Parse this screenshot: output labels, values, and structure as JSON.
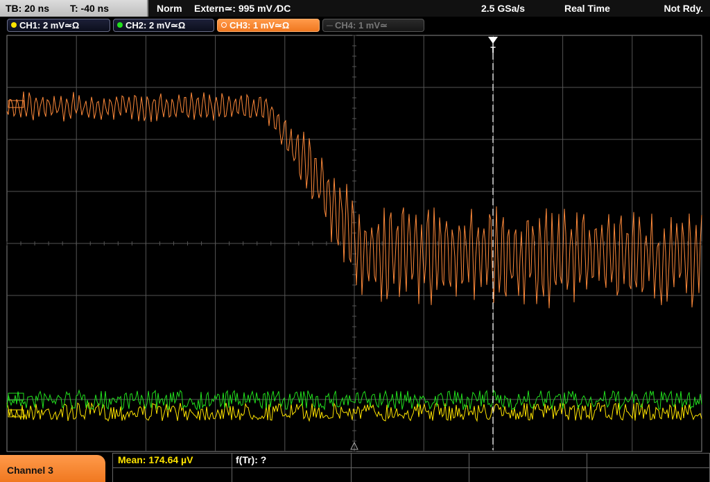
{
  "status_bar": {
    "timebase": "TB: 20 ns",
    "trigger_offset": "T: -40 ns",
    "trigger_mode": "Norm",
    "trigger_source": "Extern≃: 995 mV ∕DC",
    "sample_rate": "2.5 GSa/s",
    "acquisition_mode": "Real Time",
    "acquisition_state": "Not Rdy."
  },
  "channels": [
    {
      "id": "ch1",
      "label": "CH1: 2 mV≃Ω",
      "color": "#ffe400",
      "active": false,
      "enabled": true
    },
    {
      "id": "ch2",
      "label": "CH2: 2 mV≃Ω",
      "color": "#22e01e",
      "active": false,
      "enabled": true
    },
    {
      "id": "ch3",
      "label": "CH3: 1 mV≃Ω",
      "color": "#ff8a3a",
      "active": true,
      "enabled": true
    },
    {
      "id": "ch4",
      "label": "CH4: 1 mV≃",
      "color": "#555555",
      "active": false,
      "enabled": false
    }
  ],
  "trigger_marker": "T",
  "bottom": {
    "channel_tab": "Channel 3",
    "measurement_mean": "Mean: 174.64 µV",
    "measurement_ftr": "f(Tr): ?"
  },
  "colors": {
    "grid": "#555555",
    "ch3": "#ff8a3a",
    "ch2": "#22e01e",
    "ch1": "#ffe400",
    "accent": "#f07820"
  }
}
